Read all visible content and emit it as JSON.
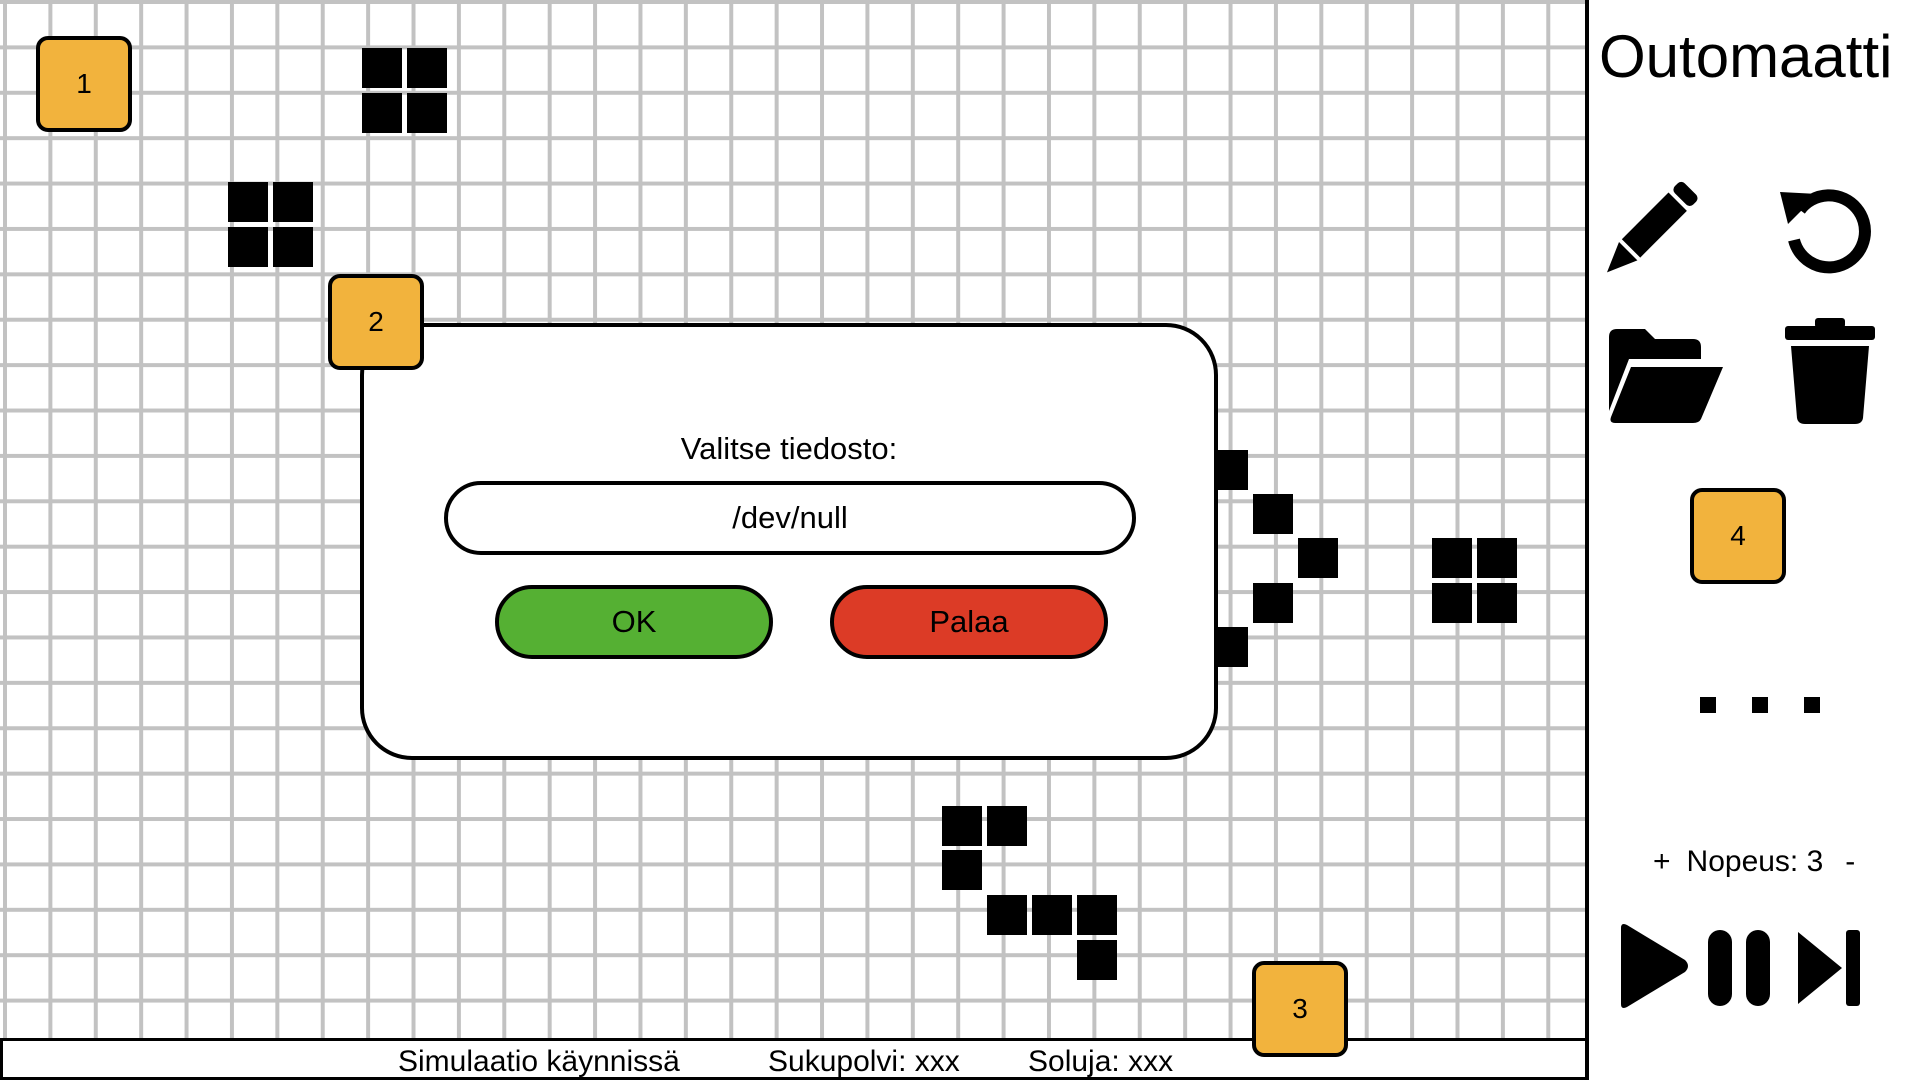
{
  "app": {
    "title": "Outomaatti"
  },
  "dialog": {
    "title": "Valitse tiedosto:",
    "file_value": "/dev/null",
    "ok_label": "OK",
    "back_label": "Palaa"
  },
  "status_bar": {
    "status": "Simulaatio käynnissä",
    "generation": "Sukupolvi: xxx",
    "cells": "Soluja: xxx"
  },
  "badges": [
    "1",
    "2",
    "3",
    "4"
  ],
  "toolbar": {
    "icons": [
      "pencil-icon",
      "reset-icon",
      "folder-open-icon",
      "trash-icon"
    ]
  },
  "speed": {
    "plus": "+",
    "label": "Nopeus: 3",
    "minus": "-"
  },
  "playback": {
    "icons": [
      "play-icon",
      "pause-icon",
      "step-icon"
    ]
  },
  "colors": {
    "badge": "#f2b33d",
    "ok_button": "#55b033",
    "back_button": "#dc3b26",
    "grid_line": "#c2c2c2",
    "cell": "#000000"
  }
}
